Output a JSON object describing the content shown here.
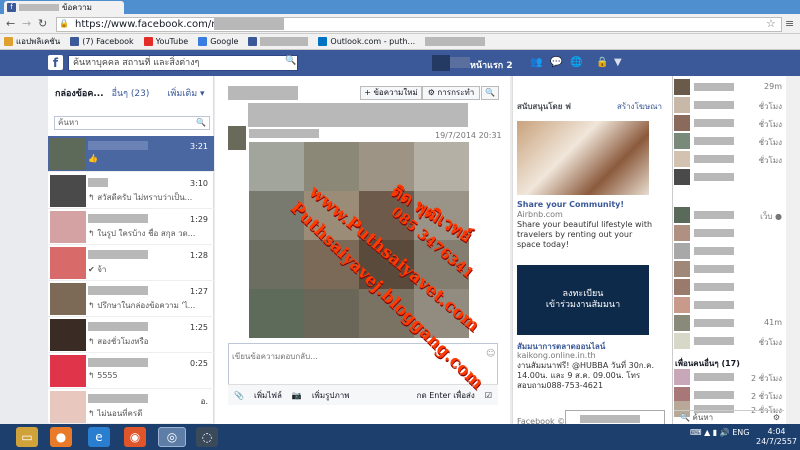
{
  "browser": {
    "tab_title": "ข้อความ",
    "url": "https://www.facebook.com/mes",
    "bookmarks": [
      "แอปพลิเคชัน",
      "(7) Facebook",
      "YouTube",
      "Google",
      "Outlook.com - puth..."
    ]
  },
  "fb": {
    "search_placeholder": "ค้นหาบุคคล สถานที่ และสิ่งต่างๆ",
    "home_label": "หน้าแรก 2"
  },
  "inbox": {
    "title": "กล่องข้อค...",
    "other": "อื่นๆ (23)",
    "more": "เพิ่มเติม ▾",
    "search_placeholder": "ค้นหา",
    "threads": [
      {
        "time": "3:21",
        "snippet": "",
        "selected": true
      },
      {
        "time": "3:10",
        "snippet": "↰ สวัสดีครับ ไม่ทราบว่าเป็น..."
      },
      {
        "time": "1:29",
        "snippet": "↰ ในรูป ใครบ้าง ชื่อ สกุล วด..."
      },
      {
        "time": "1:28",
        "snippet": "✔ จ้า"
      },
      {
        "time": "1:27",
        "snippet": "↰ ปรึกษาในกล่องข้อความ 'ไ..."
      },
      {
        "time": "1:25",
        "snippet": "↰ สองชั่วโมงหรือ"
      },
      {
        "time": "0:25",
        "snippet": "↰ 5555"
      },
      {
        "time": "อ.",
        "snippet": "↰ ไม่นอนที่ครดี"
      }
    ]
  },
  "conversation": {
    "new_message": "+ ข้อความใหม่",
    "actions": "⚙ การกระทำ",
    "date": "19/7/2014 20:31",
    "reply_placeholder": "เขียนข้อความตอบกลับ...",
    "attach_file": "เพิ่มไฟล์",
    "attach_photo": "เพิ่มรูปภาพ",
    "enter_to_send": "กด Enter เพื่อส่ง"
  },
  "ads": {
    "sponsored": "สนับสนุนโดย ฟ",
    "create_ad": "สร้างโฆษณา",
    "ad1_title": "Share your Community!",
    "ad1_url": "Airbnb.com",
    "ad1_desc": "Share your beautiful lifestyle with travelers by renting out your space today!",
    "ad2_img": "ลงทะเบียน\nเข้าร่วมงานสัมมนา",
    "ad2_title": "สัมมนาการตลาดออนไลน์",
    "ad2_url": "kaikong.online.in.th",
    "ad2_desc": "งานสัมมนาฟรี! @HUBBA วันที่ 30ก.ค. 14.00น. และ 9 ส.ค. 09.00น. โทร สอบถาม088-753-4621",
    "footer": "Facebook ©"
  },
  "chat": {
    "groups_label": "เพื่อนคนอื่นๆ (17)",
    "search_placeholder": "ค้นหา",
    "statuses": [
      "29m",
      "ชั่วโมง",
      "ชั่วโมง",
      "ชั่วโมง",
      "ชั่วโมง",
      "",
      "เว็บ ●",
      "",
      "",
      "",
      "",
      "",
      "41m",
      "ชั่วโมง",
      "2 ชั่วโมง",
      "2 ชั่วโมง",
      "2 ชั่วโมง"
    ]
  },
  "watermark": {
    "line1": "ติด พุฒิเวทย์",
    "line2": "www.Puthsaiyavet.com",
    "line3": "085 3476341",
    "line4": "Puthsaiyavej.bloggang.com"
  },
  "taskbar": {
    "lang": "ENG",
    "time": "4:04",
    "date": "24/7/2557"
  }
}
